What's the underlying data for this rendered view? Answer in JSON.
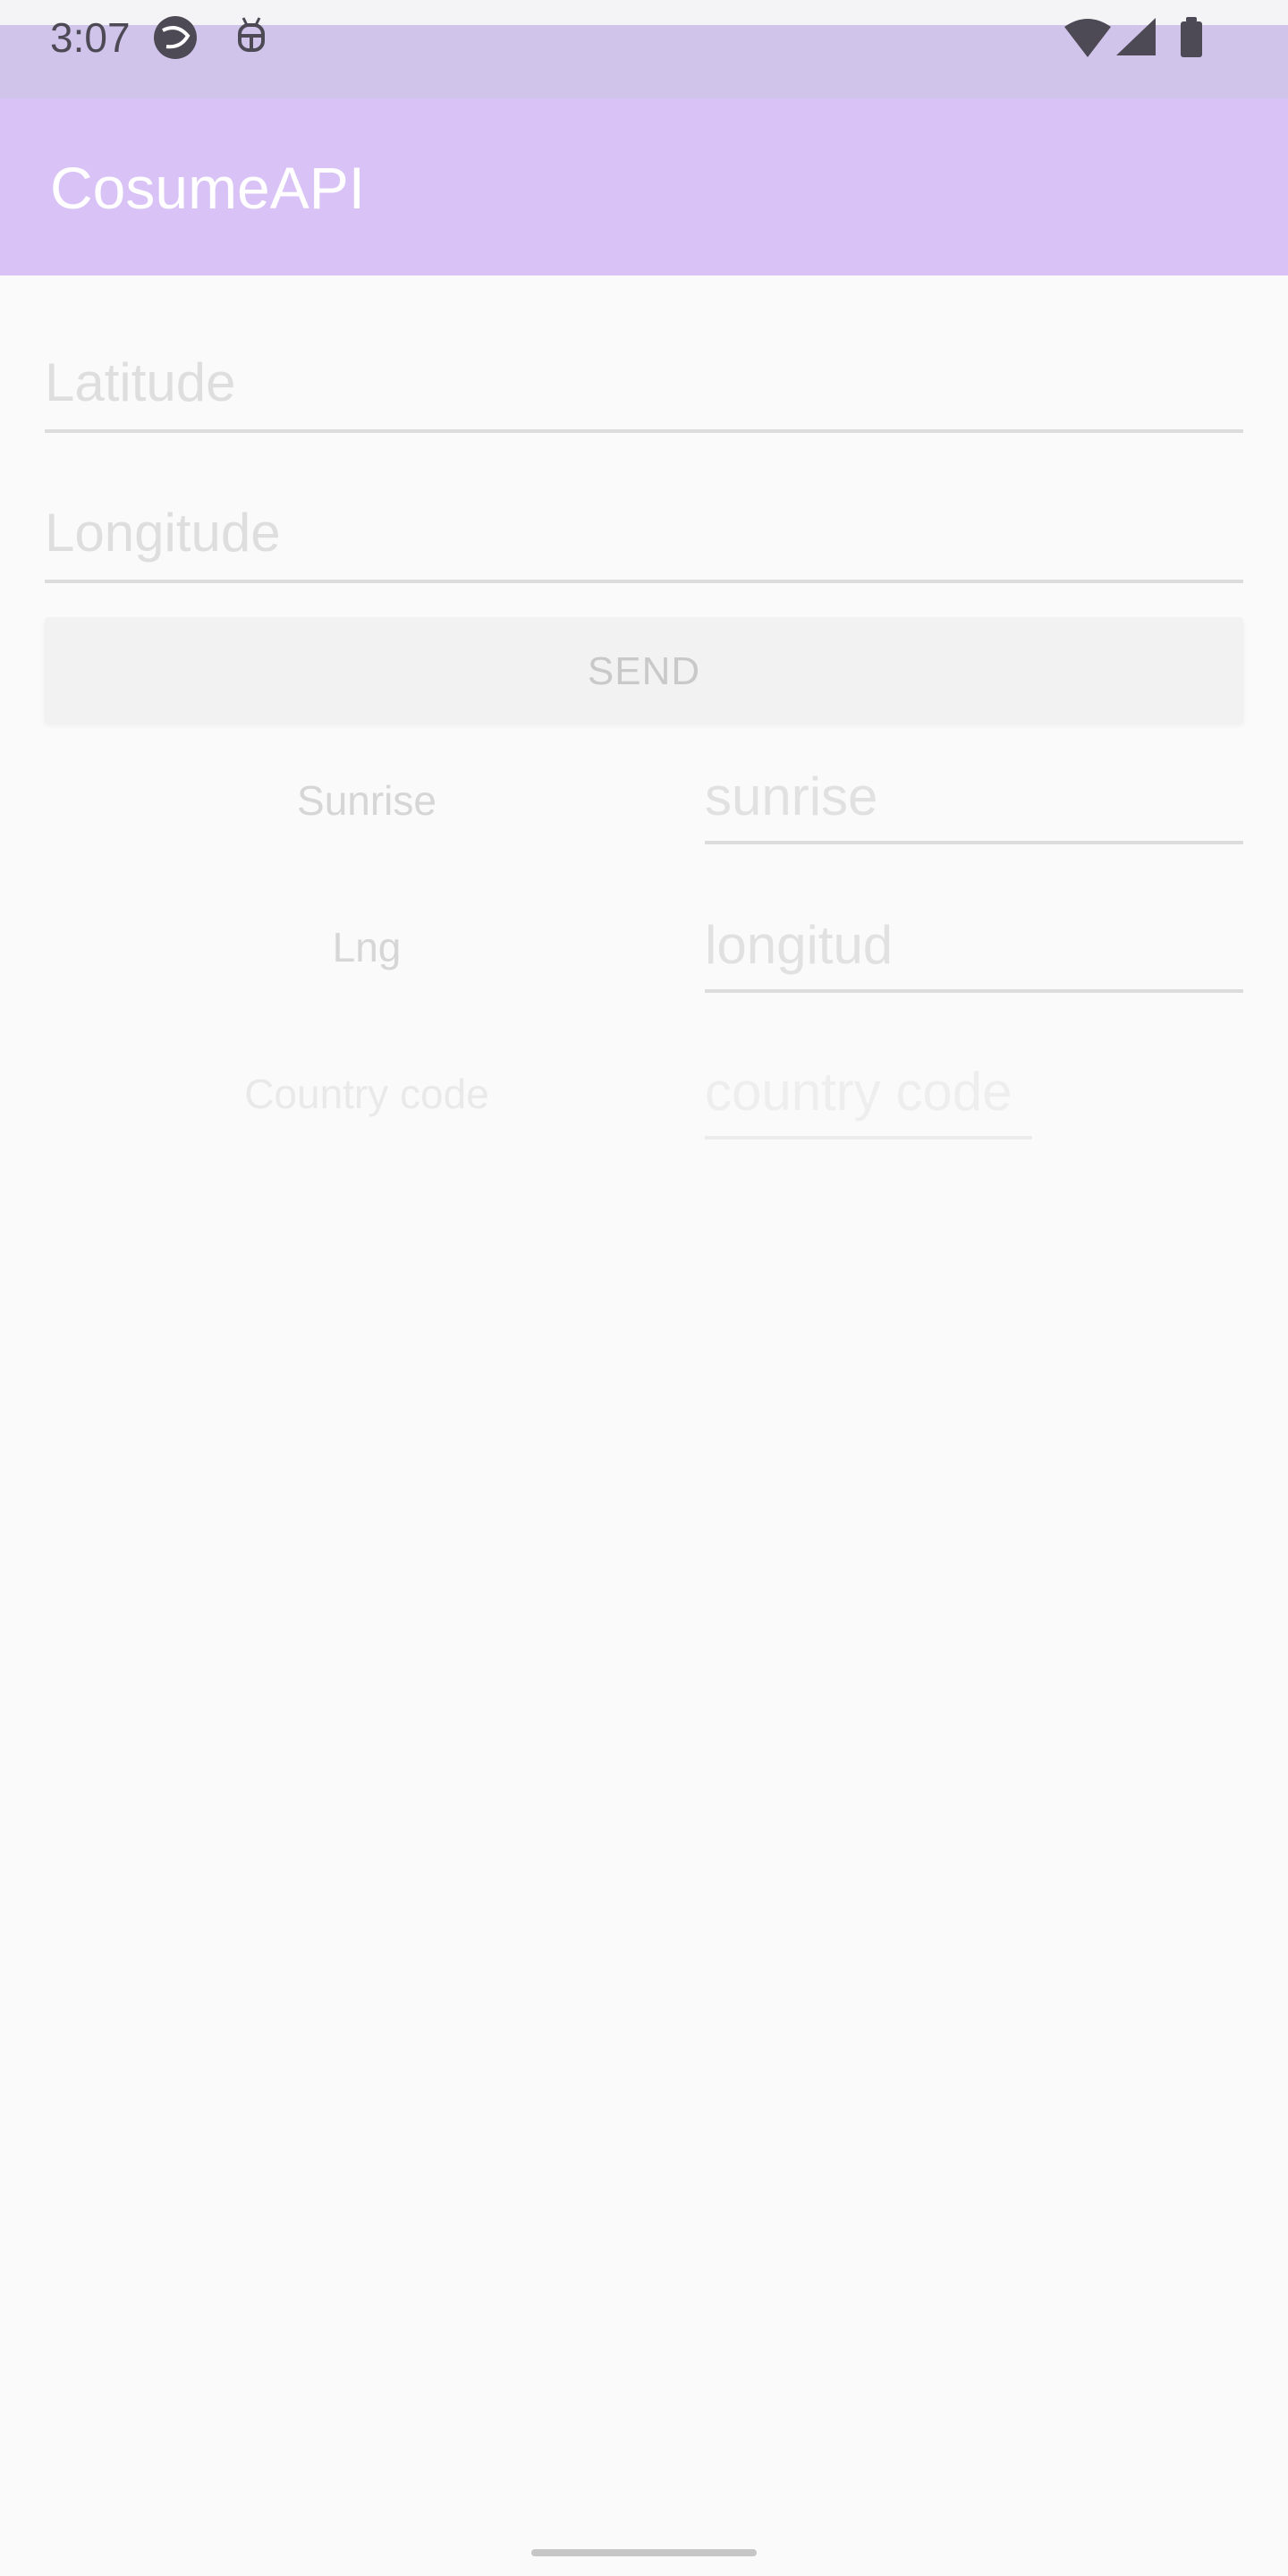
{
  "status_bar": {
    "time": "3:07",
    "left_icons": [
      "gesture-ring-icon",
      "android-debug-icon"
    ],
    "right_icons": [
      "wifi-icon",
      "cell-signal-icon",
      "battery-icon"
    ]
  },
  "app_bar": {
    "title": "CosumeAPI"
  },
  "form": {
    "latitude_placeholder": "Latitude",
    "longitude_placeholder": "Longitude",
    "send_label": "SEND"
  },
  "results": [
    {
      "label": "Sunrise",
      "placeholder": "sunrise"
    },
    {
      "label": "Lng",
      "placeholder": "longitud"
    },
    {
      "label": "Country code",
      "placeholder": "country code"
    }
  ],
  "colors": {
    "status_bar": "#d0c4ea",
    "app_bar": "#d8c2f6",
    "background": "#fafafa"
  }
}
